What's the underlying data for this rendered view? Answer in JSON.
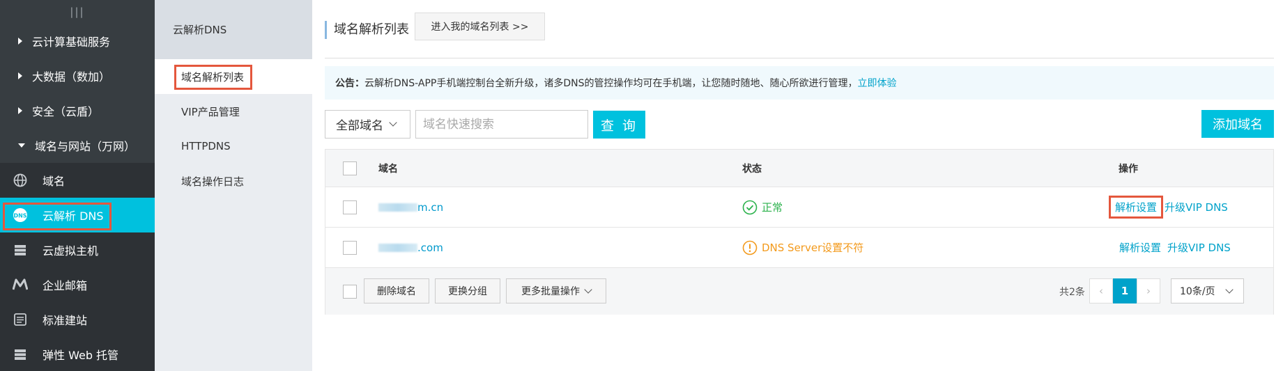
{
  "sidebar": {
    "collapse_glyph": "|||",
    "groups": [
      {
        "label": "云计算基础服务"
      },
      {
        "label": "大数据（数加）"
      },
      {
        "label": "安全（云盾）"
      },
      {
        "label": "域名与网站（万网）"
      }
    ],
    "items": [
      {
        "label": "域名",
        "icon": "globe-icon"
      },
      {
        "label": "云解析 DNS",
        "icon": "dns-icon",
        "active": true
      },
      {
        "label": "云虚拟主机",
        "icon": "server-icon"
      },
      {
        "label": "企业邮箱",
        "icon": "mail-m-icon"
      },
      {
        "label": "标准建站",
        "icon": "site-icon"
      },
      {
        "label": "弹性 Web 托管",
        "icon": "server-icon"
      }
    ]
  },
  "subnav": {
    "title": "云解析DNS",
    "items": [
      {
        "label": "域名解析列表",
        "active": true
      },
      {
        "label": "VIP产品管理"
      },
      {
        "label": "HTTPDNS"
      },
      {
        "label": "域名操作日志"
      }
    ]
  },
  "header": {
    "title": "域名解析列表",
    "domain_list_button": "进入我的域名列表 >>"
  },
  "notice": {
    "prefix": "公告：",
    "text": "云解析DNS-APP手机端控制台全新升级，诸多DNS的管控操作均可在手机端，让您随时随地、随心所欲进行管理，",
    "link": "立即体验"
  },
  "toolbar": {
    "filter_value": "全部域名",
    "search_placeholder": "域名快速搜索",
    "query_button": "查 询",
    "add_button": "添加域名"
  },
  "table": {
    "columns": {
      "domain": "域名",
      "status": "状态",
      "operation": "操作"
    },
    "rows": [
      {
        "domain_suffix": "m.cn",
        "status": "正常",
        "status_type": "ok",
        "op1": "解析设置",
        "op2": "升级VIP DNS"
      },
      {
        "domain_suffix": ".com",
        "status": "DNS Server设置不符",
        "status_type": "warn",
        "op1": "解析设置",
        "op2": "升级VIP DNS"
      }
    ]
  },
  "footer": {
    "delete_button": "删除域名",
    "group_button": "更换分组",
    "batch_button": "更多批量操作",
    "total": "共2条",
    "prev": "‹",
    "current_page": "1",
    "next": "›",
    "page_size": "10条/页"
  },
  "colors": {
    "accent": "#00c1de",
    "highlight": "#e4573d",
    "link": "#00a2ca",
    "ok": "#2bb24c",
    "warn": "#f39a1c"
  }
}
